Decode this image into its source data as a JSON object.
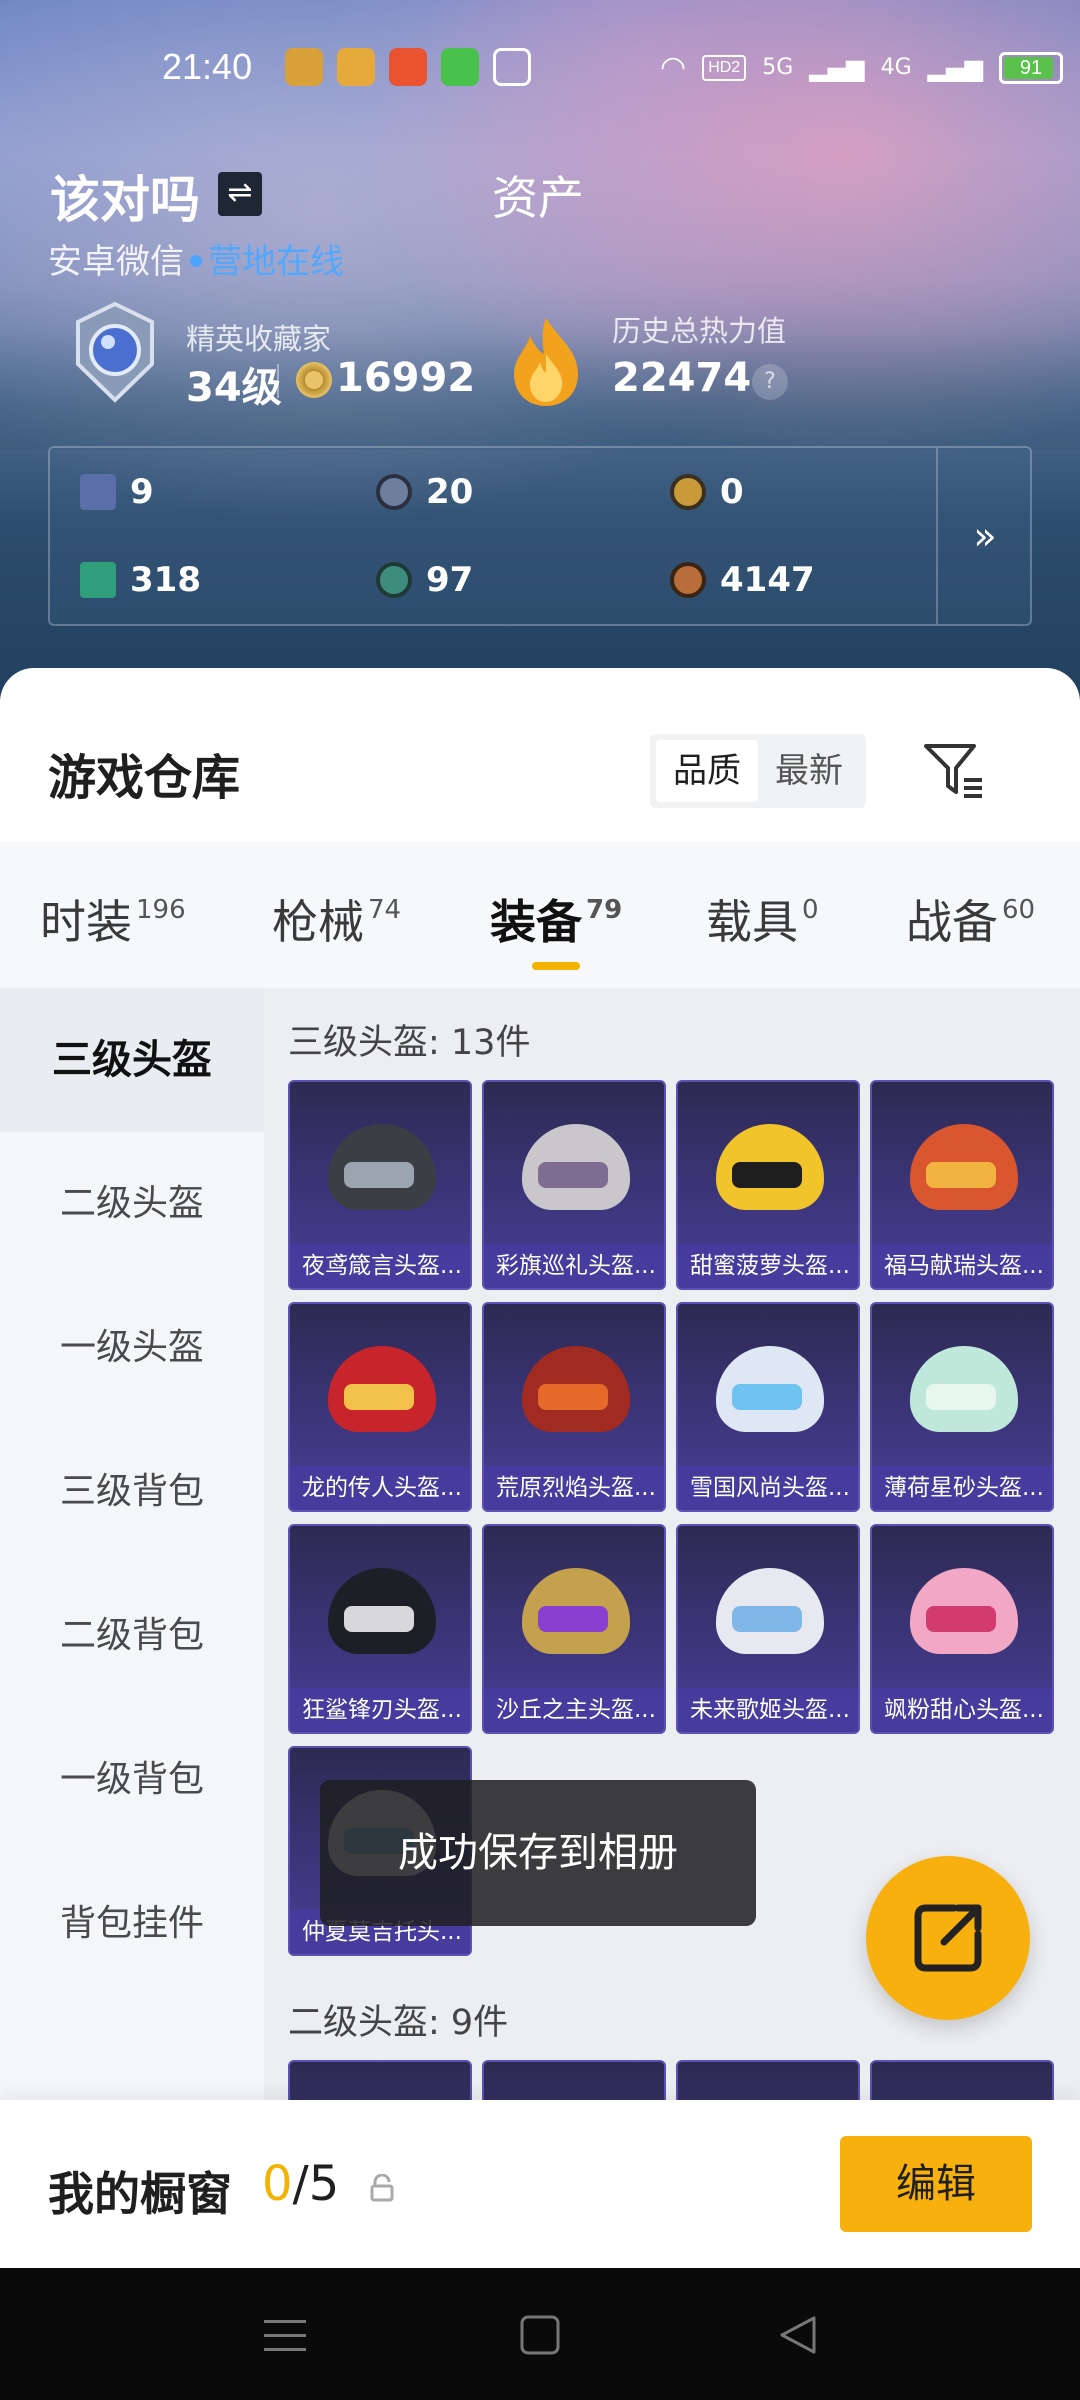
{
  "statusbar": {
    "time": "21:40",
    "apps": [
      "#d9a13a",
      "#e6a93b",
      "#e9532f",
      "#48c24a",
      "#ffffff"
    ],
    "network_hd": "HD2",
    "network_5g": "5G",
    "network_4g": "4G",
    "battery": "91",
    "battery_level": 0.91
  },
  "header": {
    "username": "该对吗",
    "switch_icon": "swap-icon",
    "assets_title": "资产",
    "platform": "安卓微信",
    "status": "营地在线",
    "rank_title": "精英收藏家",
    "rank_level": "34级",
    "coin_value": "16992",
    "heat_title": "历史总热力值",
    "heat_value": "22474",
    "help": "?"
  },
  "currencies": [
    {
      "icon": "card-icon",
      "value": "9",
      "color": "#5b6ea8"
    },
    {
      "icon": "s-coin-icon",
      "value": "20",
      "color": "#6e7f9e"
    },
    {
      "icon": "a-coin-icon",
      "value": "0",
      "color": "#c89a3a"
    },
    {
      "icon": "ticket-icon",
      "value": "318",
      "color": "#2f9e7a"
    },
    {
      "icon": "orb-icon",
      "value": "97",
      "color": "#3e8c7e"
    },
    {
      "icon": "bronze-coin-icon",
      "value": "4147",
      "color": "#b86d3a"
    }
  ],
  "currency_more": "»",
  "warehouse": {
    "title": "游戏仓库",
    "sort_quality": "品质",
    "sort_newest": "最新"
  },
  "tabs": [
    {
      "label": "时装",
      "count": "196"
    },
    {
      "label": "枪械",
      "count": "74"
    },
    {
      "label": "装备",
      "count": "79"
    },
    {
      "label": "载具",
      "count": "0"
    },
    {
      "label": "战备",
      "count": "60"
    }
  ],
  "sidebar": [
    "三级头盔",
    "二级头盔",
    "一级头盔",
    "三级背包",
    "二级背包",
    "一级背包",
    "背包挂件"
  ],
  "section1_title": "三级头盔: 13件",
  "section2_title": "二级头盔: 9件",
  "items": [
    {
      "label": "夜鸢箴言头盔...",
      "body": "#3a3f46",
      "visor": "#9aa5b0"
    },
    {
      "label": "彩旗巡礼头盔...",
      "body": "#c9c7cc",
      "visor": "#7f6c92"
    },
    {
      "label": "甜蜜菠萝头盔...",
      "body": "#f0c42a",
      "visor": "#1e1e1e"
    },
    {
      "label": "福马献瑞头盔...",
      "body": "#d9562f",
      "visor": "#f3b340"
    },
    {
      "label": "龙的传人头盔...",
      "body": "#c7252b",
      "visor": "#f2c14a"
    },
    {
      "label": "荒原烈焰头盔...",
      "body": "#a12b20",
      "visor": "#e56a2a"
    },
    {
      "label": "雪国风尚头盔...",
      "body": "#dfe6f4",
      "visor": "#6fc3f0"
    },
    {
      "label": "薄荷星砂头盔...",
      "body": "#bfe8da",
      "visor": "#e8f6f0"
    },
    {
      "label": "狂鲨锋刃头盔...",
      "body": "#1e1f26",
      "visor": "#d8d8dc"
    },
    {
      "label": "沙丘之主头盔...",
      "body": "#c4a14c",
      "visor": "#8b3fd0"
    },
    {
      "label": "未来歌姬头盔...",
      "body": "#e8e8f0",
      "visor": "#7fb8e8"
    },
    {
      "label": "飒粉甜心头盔...",
      "body": "#f2a8c4",
      "visor": "#d23b6e"
    },
    {
      "label": "仲夏莫吉托头...",
      "body": "#f4f6f8",
      "visor": "#7fd3e8"
    }
  ],
  "toast": "成功保存到相册",
  "showcase": {
    "title": "我的橱窗",
    "current": "0",
    "total": "/5",
    "edit": "编辑"
  },
  "colors": {
    "accent": "#f7b00d",
    "online": "#52a8ff",
    "card": "#3c357a"
  }
}
